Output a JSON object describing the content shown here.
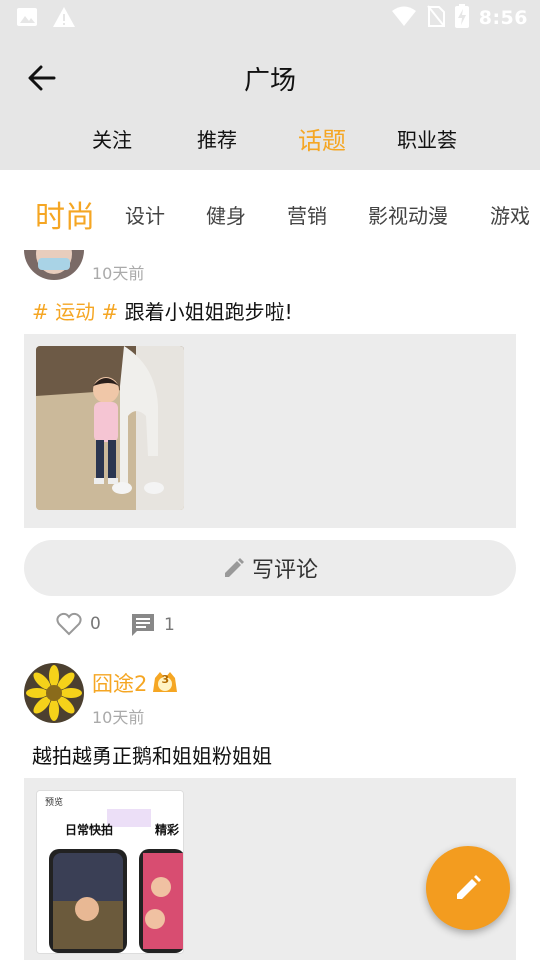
{
  "status_bar": {
    "time": "8:56"
  },
  "header": {
    "title": "广场"
  },
  "main_tabs": [
    {
      "label": "关注",
      "active": false
    },
    {
      "label": "推荐",
      "active": false
    },
    {
      "label": "话题",
      "active": true
    },
    {
      "label": "职业荟",
      "active": false
    }
  ],
  "category_tabs": [
    {
      "label": "时尚",
      "active": true
    },
    {
      "label": "设计",
      "active": false
    },
    {
      "label": "健身",
      "active": false
    },
    {
      "label": "营销",
      "active": false
    },
    {
      "label": "影视动漫",
      "active": false
    },
    {
      "label": "游戏",
      "active": false
    }
  ],
  "posts": [
    {
      "time": "10天前",
      "tag": "# 运动 #",
      "text": "跟着小姐姐跑步啦!",
      "comment_button": "写评论",
      "likes": "0",
      "comments": "1"
    },
    {
      "username": "囧途2",
      "level": "3",
      "time": "10天前",
      "text": "越拍越勇正鹅和姐姐粉姐姐",
      "screenshot_labels": {
        "header": "预览",
        "left": "日常快拍",
        "right": "精彩"
      }
    }
  ],
  "colors": {
    "accent": "#f5a623",
    "fab": "#f39c1f",
    "bar": "#e6e6e6"
  },
  "icons": {
    "fab": "edit-pencil-icon",
    "like": "heart-outline-icon",
    "comment": "comment-bubble-icon",
    "back": "arrow-back-icon"
  }
}
